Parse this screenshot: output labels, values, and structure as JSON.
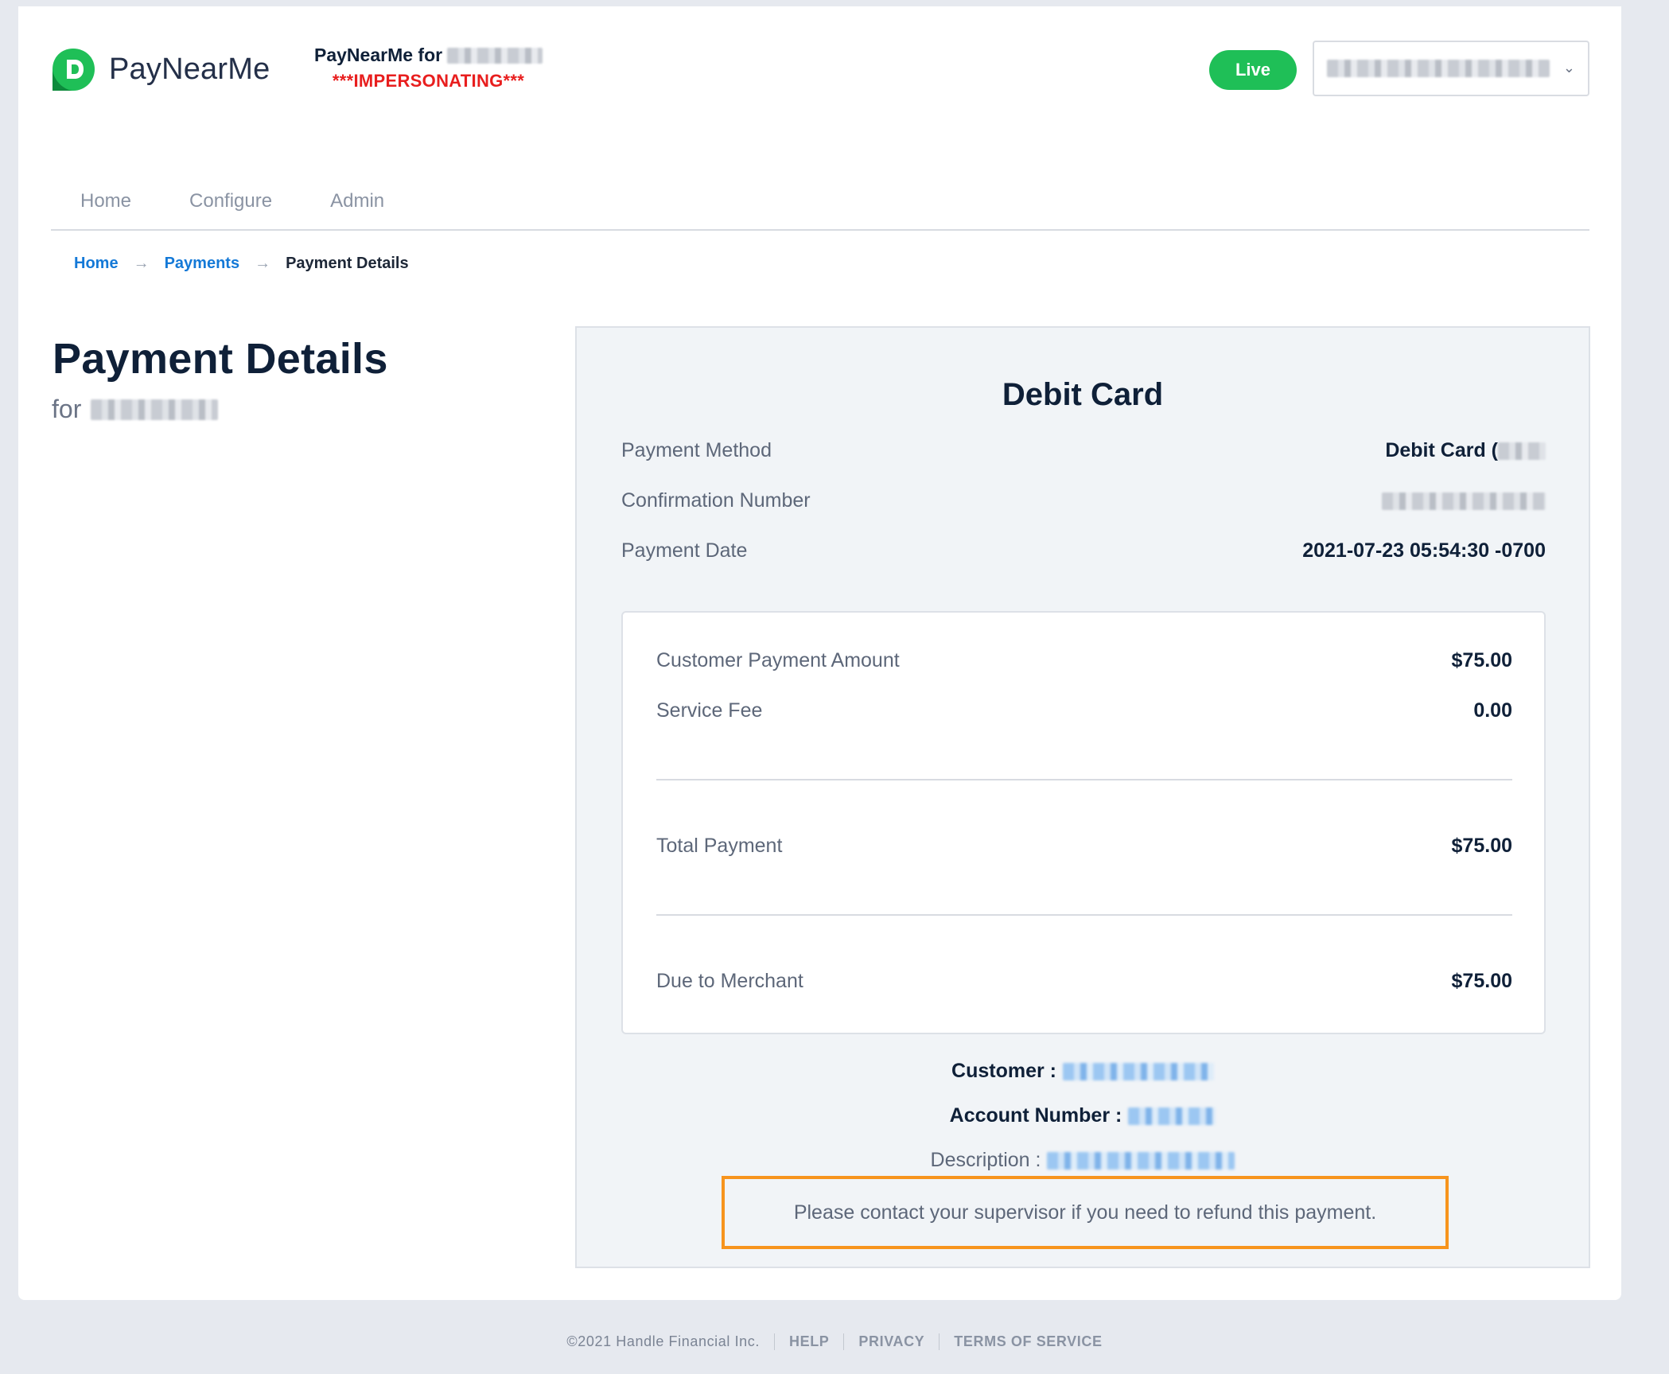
{
  "header": {
    "brand": "PayNearMe",
    "merchant_prefix": "PayNearMe for",
    "impersonating": "***IMPERSONATING***",
    "env_badge": "Live"
  },
  "nav": [
    {
      "label": "Home"
    },
    {
      "label": "Configure"
    },
    {
      "label": "Admin"
    }
  ],
  "breadcrumb": {
    "home": "Home",
    "payments": "Payments",
    "current": "Payment Details",
    "separator": "→"
  },
  "page": {
    "title": "Payment Details",
    "for_label": "for"
  },
  "panel": {
    "title": "Debit Card",
    "rows": [
      {
        "label": "Payment Method",
        "value": "Debit Card ("
      },
      {
        "label": "Confirmation Number",
        "value": ""
      },
      {
        "label": "Payment Date",
        "value": "2021-07-23 05:54:30 -0700"
      }
    ],
    "summary": {
      "customer_payment_amount_label": "Customer Payment Amount",
      "customer_payment_amount": "$75.00",
      "service_fee_label": "Service Fee",
      "service_fee": "0.00",
      "total_payment_label": "Total Payment",
      "total_payment": "$75.00",
      "due_to_merchant_label": "Due to Merchant",
      "due_to_merchant": "$75.00"
    },
    "customer_label": "Customer :",
    "account_number_label": "Account Number :",
    "description_label": "Description :",
    "refund_note": "Please contact your supervisor if you need to refund this payment."
  },
  "footer": {
    "copyright": "©2021 Handle Financial Inc.",
    "help": "HELP",
    "privacy": "PRIVACY",
    "terms": "TERMS OF SERVICE"
  },
  "colors": {
    "accent_blue": "#1479d7",
    "live_green": "#1fbf57",
    "impersonating_red": "#e81e1e",
    "highlight_orange": "#f7941d"
  }
}
